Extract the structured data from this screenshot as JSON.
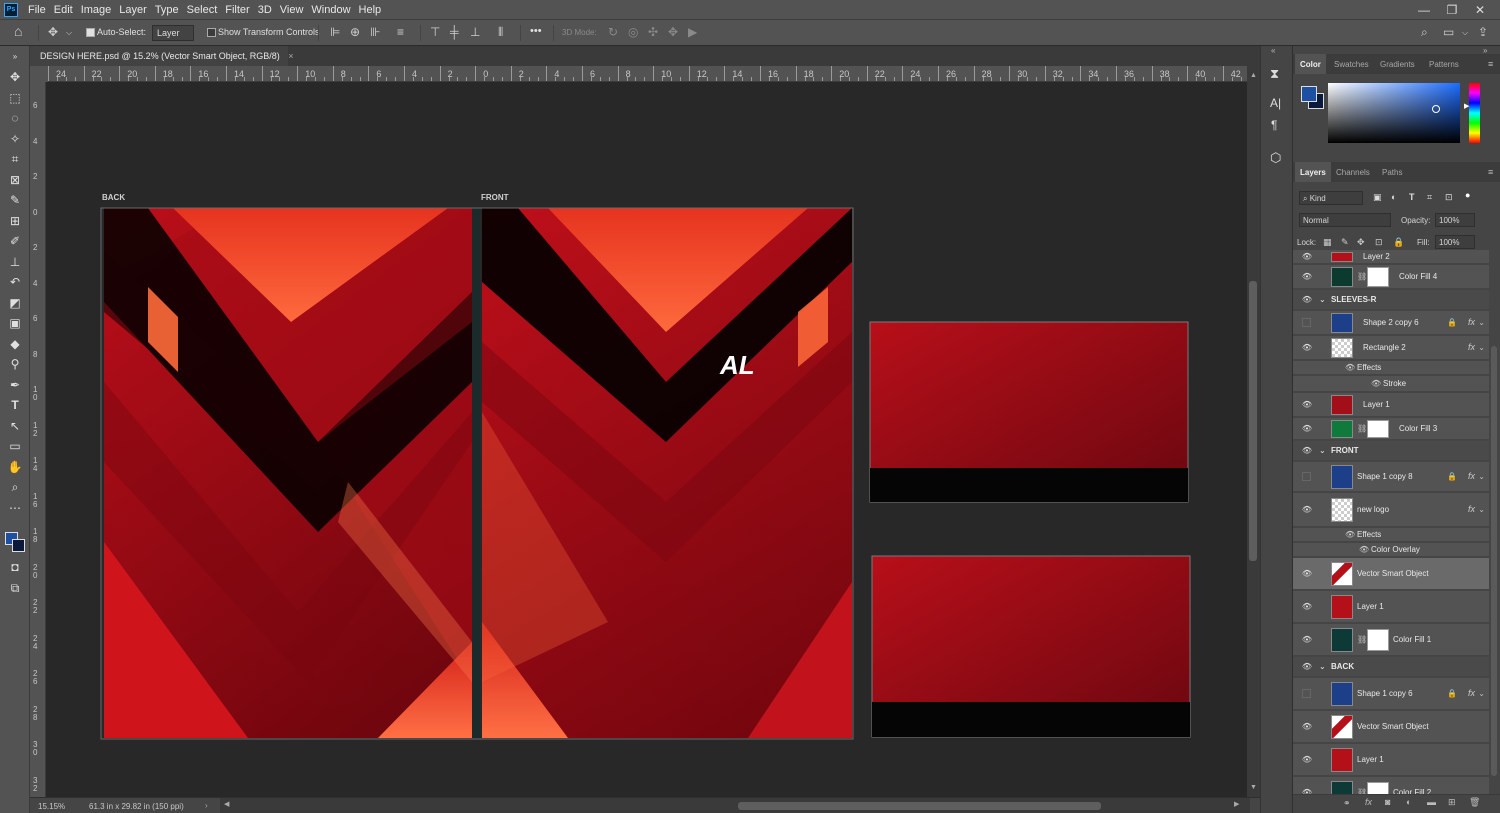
{
  "app": {
    "logo": "Ps"
  },
  "menu": [
    "File",
    "Edit",
    "Image",
    "Layer",
    "Type",
    "Select",
    "Filter",
    "3D",
    "View",
    "Window",
    "Help"
  ],
  "window_controls": {
    "minimize": "—",
    "maximize": "❐",
    "close": "✕"
  },
  "options": {
    "auto_select_label": "Auto-Select:",
    "auto_select_checked": true,
    "target_value": "Layer",
    "show_transform_label": "Show Transform Controls",
    "show_transform_checked": false,
    "more": "•••",
    "mode_label": "3D Mode:"
  },
  "document_tab": {
    "title": "DESIGN HERE.psd @ 15.2% (Vector Smart Object, RGB/8)",
    "close": "×"
  },
  "rulers": {
    "horizontal": [
      "24",
      "22",
      "20",
      "18",
      "16",
      "14",
      "12",
      "10",
      "8",
      "6",
      "4",
      "2",
      "0",
      "2",
      "4",
      "6",
      "8",
      "10",
      "12",
      "14",
      "16",
      "18",
      "20",
      "22",
      "24",
      "26",
      "28",
      "30",
      "32",
      "34",
      "36",
      "38",
      "40",
      "42"
    ],
    "vertical": [
      "6",
      "4",
      "2",
      "0",
      "2",
      "4",
      "6",
      "8",
      "1 0",
      "1 2",
      "1 4",
      "1 6",
      "1 8",
      "2 0",
      "2 2",
      "2 4",
      "2 6",
      "2 8",
      "3 0",
      "3 2"
    ]
  },
  "canvas": {
    "back_label": "BACK",
    "front_label": "FRONT",
    "logo_text": "AL"
  },
  "status": {
    "zoom": "15.15%",
    "doc_size": "61.3 in x 29.82 in (150 ppi)"
  },
  "color_panel": {
    "tabs": [
      "Color",
      "Swatches",
      "Gradients",
      "Patterns"
    ],
    "active_tab": "Color",
    "foreground": "#1d4fa3",
    "background": "#0b1a3a"
  },
  "layers_panel": {
    "tabs": [
      "Layers",
      "Channels",
      "Paths"
    ],
    "active_tab": "Layers",
    "filter_label": "Kind",
    "blend_mode": "Normal",
    "opacity_label": "Opacity:",
    "opacity_value": "100%",
    "lock_label": "Lock:",
    "fill_label": "Fill:",
    "fill_value": "100%",
    "rows": [
      {
        "name": "Layer 2",
        "type": "layer"
      },
      {
        "name": "Color Fill 4",
        "type": "fill"
      },
      {
        "name": "SLEEVES-R",
        "type": "group"
      },
      {
        "name": "Shape 2 copy 6",
        "type": "shape"
      },
      {
        "name": "Rectangle 2",
        "type": "shape"
      },
      {
        "name": "Effects",
        "type": "effects"
      },
      {
        "name": "Stroke",
        "type": "effect"
      },
      {
        "name": "Layer 1",
        "type": "layer"
      },
      {
        "name": "Color Fill 3",
        "type": "fill"
      },
      {
        "name": "FRONT",
        "type": "group"
      },
      {
        "name": "Shape 1 copy 8",
        "type": "shape"
      },
      {
        "name": "new logo",
        "type": "smart"
      },
      {
        "name": "Effects",
        "type": "effects"
      },
      {
        "name": "Color Overlay",
        "type": "effect"
      },
      {
        "name": "Vector Smart Object",
        "type": "smart"
      },
      {
        "name": "Layer 1",
        "type": "layer"
      },
      {
        "name": "Color Fill 1",
        "type": "fill"
      },
      {
        "name": "BACK",
        "type": "group"
      },
      {
        "name": "Shape 1 copy 6",
        "type": "shape"
      },
      {
        "name": "Vector Smart Object",
        "type": "smart"
      },
      {
        "name": "Layer 1",
        "type": "layer"
      },
      {
        "name": "Color Fill 2",
        "type": "fill"
      }
    ],
    "fx_symbol": "fx"
  }
}
